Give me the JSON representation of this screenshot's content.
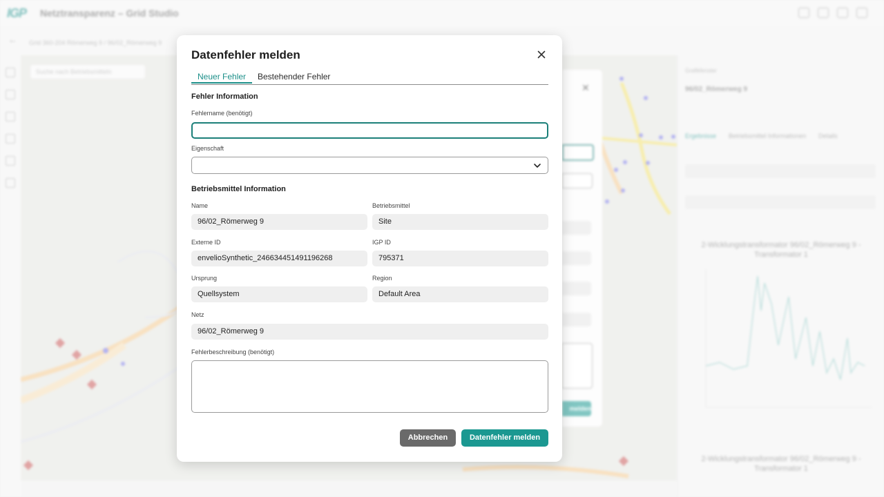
{
  "app": {
    "title": "Netztransparenz – Grid Studio",
    "breadcrumb": "Grid 360-204 Römerweg 9 / 96/02_Römerweg 9",
    "map_search_placeholder": "Suche nach Betriebsmitteln"
  },
  "right_panel": {
    "header": "Grafikfenster",
    "title": "96/02_Römerweg 9",
    "tabs": [
      "Ergebnisse",
      "Betriebsmittel Informationen",
      "Details"
    ],
    "chart1_title": "2-Wicklungstransformator 96/02_Römerweg 9 - Transformator 1",
    "chart2_title": "2-Wicklungstransformator 96/02_Römerweg 9 - Transformator 1"
  },
  "background_dialog": {
    "button_label": "melden"
  },
  "dialog": {
    "title": "Datenfehler melden",
    "tabs": {
      "new": "Neuer Fehler",
      "existing": "Bestehender Fehler"
    },
    "error_info": {
      "heading": "Fehler Information",
      "name_label": "Fehlername (benötigt)",
      "name_value": "",
      "property_label": "Eigenschaft",
      "property_value": ""
    },
    "asset_info": {
      "heading": "Betriebsmittel Information",
      "name_label": "Name",
      "name_value": "96/02_Römerweg 9",
      "asset_label": "Betriebsmittel",
      "asset_value": "Site",
      "external_id_label": "Externe ID",
      "external_id_value": "envelioSynthetic_246634451491196268",
      "igp_id_label": "IGP ID",
      "igp_id_value": "795371",
      "origin_label": "Ursprung",
      "origin_value": "Quellsystem",
      "region_label": "Region",
      "region_value": "Default Area",
      "grid_label": "Netz",
      "grid_value": "96/02_Römerweg 9"
    },
    "description_label": "Fehlerbeschreibung (benötigt)",
    "description_value": "",
    "cancel_label": "Abbrechen",
    "submit_label": "Datenfehler melden"
  },
  "colors": {
    "accent": "#1b9891",
    "cancel": "#6a6a6a"
  }
}
